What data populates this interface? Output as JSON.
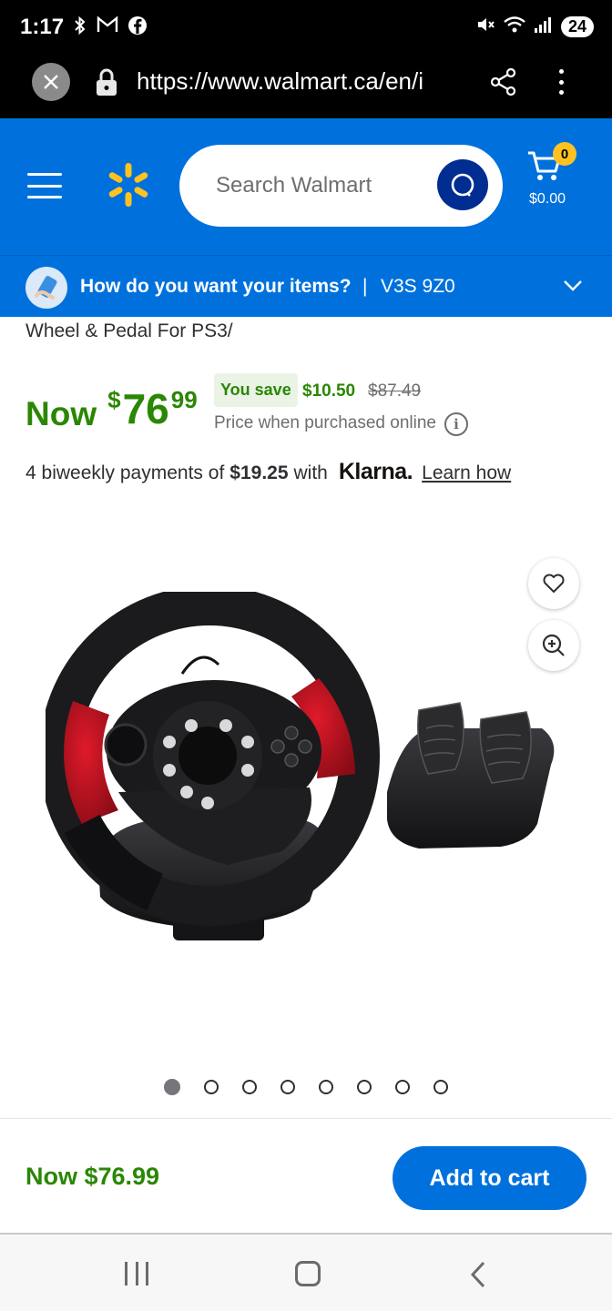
{
  "status_bar": {
    "time": "1:17",
    "left_icons": [
      "bluetooth-icon",
      "gmail-icon",
      "facebook-icon"
    ],
    "battery": "24"
  },
  "browser": {
    "url": "https://www.walmart.ca/en/i"
  },
  "header": {
    "search_placeholder": "Search Walmart",
    "cart_count": "0",
    "cart_total": "$0.00",
    "brand_color": "#0071dc",
    "accent_color": "#ffc220"
  },
  "fulfillment": {
    "question": "How do you want your items?",
    "separator": "|",
    "postal_code": "V3S 9Z0"
  },
  "product": {
    "title_fragment": "Wheel & Pedal For PS3/",
    "price_label": "Now",
    "currency": "$",
    "price_dollars": "76",
    "price_cents": "99",
    "you_save_label": "You save",
    "save_amount": "$10.50",
    "was_price": "$87.49",
    "price_note": "Price when purchased online",
    "info_glyph": "i",
    "price_color": "#2a8703"
  },
  "klarna": {
    "prefix": "4 biweekly payments of",
    "amount": "$19.25",
    "with": "with",
    "brand": "Klarna.",
    "learn_link": "Learn how"
  },
  "gallery": {
    "image_count": 8,
    "active_index": 0
  },
  "sticky": {
    "price": "Now $76.99",
    "add_to_cart": "Add to cart"
  }
}
